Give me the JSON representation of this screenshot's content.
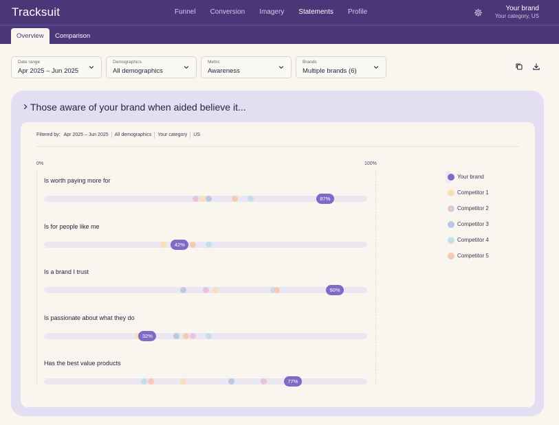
{
  "app": {
    "logo": "Tracksuit"
  },
  "nav": {
    "items": [
      {
        "label": "Funnel",
        "active": false
      },
      {
        "label": "Conversion",
        "active": false
      },
      {
        "label": "Imagery",
        "active": false
      },
      {
        "label": "Statements",
        "active": true
      },
      {
        "label": "Profile",
        "active": false
      }
    ]
  },
  "account": {
    "brand": "Your brand",
    "category": "Your category, US",
    "settings_icon": "gear-icon"
  },
  "tabs": [
    {
      "label": "Overview",
      "active": true
    },
    {
      "label": "Comparison",
      "active": false
    }
  ],
  "filters": [
    {
      "label": "Date range",
      "value": "Apr 2025 – Jun 2025"
    },
    {
      "label": "Demographics",
      "value": "All demographics"
    },
    {
      "label": "Metric",
      "value": "Awareness"
    },
    {
      "label": "Brands",
      "value": "Multiple brands (6)"
    }
  ],
  "actions": {
    "copy_icon": "copy-icon",
    "download_icon": "download-icon"
  },
  "panel": {
    "title": "Those aware of your brand when aided believe it..."
  },
  "filtered_by": {
    "label": "Filtered by:",
    "items": [
      "Apr 2025 – Jun 2025",
      "All demographics",
      "Your category",
      "US"
    ]
  },
  "axis": {
    "min_label": "0%",
    "max_label": "100%"
  },
  "colors": {
    "your_brand": "#7f6bc6",
    "competitor_1": "#f8dfb8",
    "competitor_2": "#e9c4df",
    "competitor_3": "#bcc9e2",
    "competitor_4": "#c3e0ea",
    "competitor_5": "#f4cab3"
  },
  "legend": [
    {
      "label": "Your brand",
      "key": "your_brand"
    },
    {
      "label": "Competitor 1",
      "key": "competitor_1"
    },
    {
      "label": "Competitor 2",
      "key": "competitor_2"
    },
    {
      "label": "Competitor 3",
      "key": "competitor_3"
    },
    {
      "label": "Competitor 4",
      "key": "competitor_4"
    },
    {
      "label": "Competitor 5",
      "key": "competitor_5"
    }
  ],
  "chart_data": {
    "type": "scatter",
    "xlim": [
      0,
      100
    ],
    "series_names": [
      "Your brand",
      "Competitor 1",
      "Competitor 2",
      "Competitor 3",
      "Competitor 4",
      "Competitor 5"
    ],
    "statements": [
      {
        "label": "Is worth paying more for",
        "your_brand": 87,
        "competitor_1": 49,
        "competitor_2": 47,
        "competitor_3": 51,
        "competitor_4": 64,
        "competitor_5": 59,
        "value_label": "87%"
      },
      {
        "label": "Is for people like me",
        "your_brand": 42,
        "competitor_1": 37,
        "competitor_2": 40,
        "competitor_3": 41,
        "competitor_4": 51,
        "competitor_5": 46,
        "value_label": "42%"
      },
      {
        "label": "Is a brand I trust",
        "your_brand": 90,
        "competitor_1": 53,
        "competitor_2": 50,
        "competitor_3": 43,
        "competitor_4": 71,
        "competitor_5": 72,
        "value_label": "90%"
      },
      {
        "label": "Is passionate about what they do",
        "your_brand": 32,
        "competitor_1": 29,
        "competitor_2": 46,
        "competitor_3": 41,
        "competitor_4": 51,
        "competitor_5": 44,
        "value_label": "32%"
      },
      {
        "label": "Has the best value products",
        "your_brand": 77,
        "competitor_1": 43,
        "competitor_2": 68,
        "competitor_3": 58,
        "competitor_4": 31,
        "competitor_5": 33,
        "value_label": "77%"
      }
    ]
  }
}
